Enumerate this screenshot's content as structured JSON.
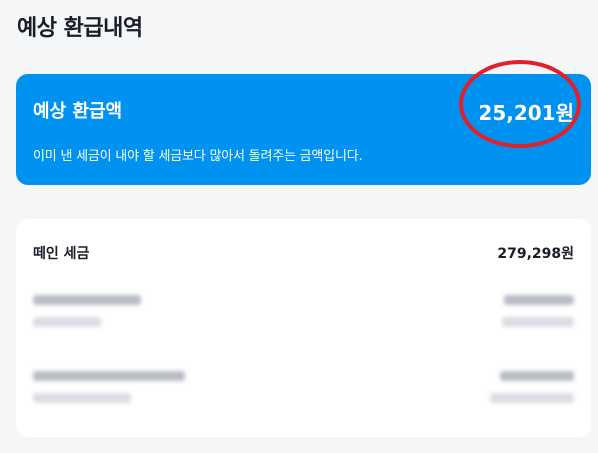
{
  "page": {
    "title": "예상 환급내역"
  },
  "summary": {
    "label": "예상 환급액",
    "amount": "25,201원",
    "description": "이미 낸 세금이 내야 할 세금보다 많아서 돌려주는 금액입니다."
  },
  "details": {
    "withheld_label": "떼인 세금",
    "withheld_amount": "279,298원"
  },
  "colors": {
    "accent": "#0092f0",
    "highlight": "#e0202a"
  }
}
